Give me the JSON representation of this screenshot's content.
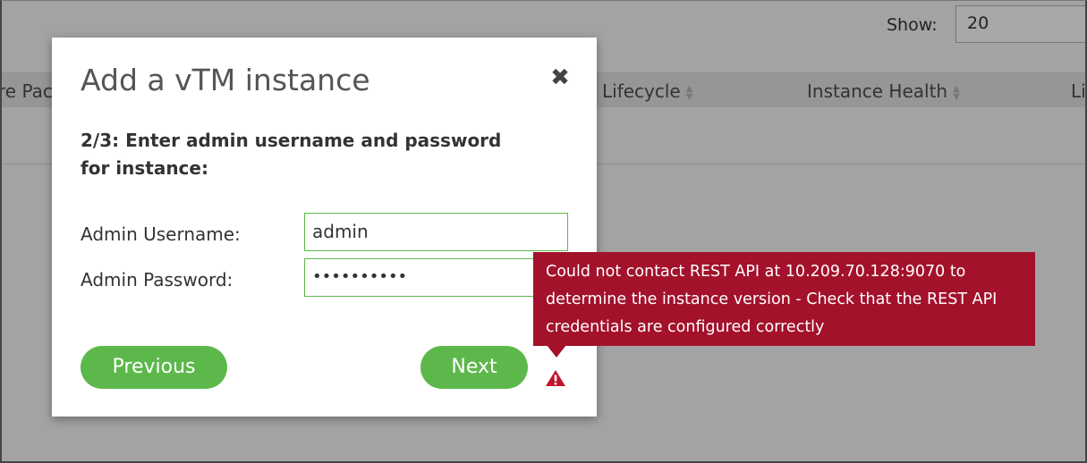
{
  "background": {
    "show_label": "Show:",
    "show_value": "20",
    "columns": [
      "re Pac",
      "Lifecycle",
      "Instance Health",
      "Li"
    ]
  },
  "modal": {
    "title": "Add a vTM instance",
    "close_symbol": "✖",
    "step_text": "2/3: Enter admin username and password for instance:",
    "username_label": "Admin Username:",
    "username_value": "admin",
    "password_label": "Admin Password:",
    "password_value": "••••••••••",
    "previous_label": "Previous",
    "next_label": "Next",
    "warning_icon": "warning-triangle-icon"
  },
  "error_tooltip": {
    "message": "Could not contact REST API at 10.209.70.128:9070 to determine the instance version - Check that the REST API credentials are configured correctly"
  },
  "colors": {
    "accent_green": "#5db84b",
    "error_red": "#a3112b",
    "overlay_gray": "#a3a3a3"
  }
}
